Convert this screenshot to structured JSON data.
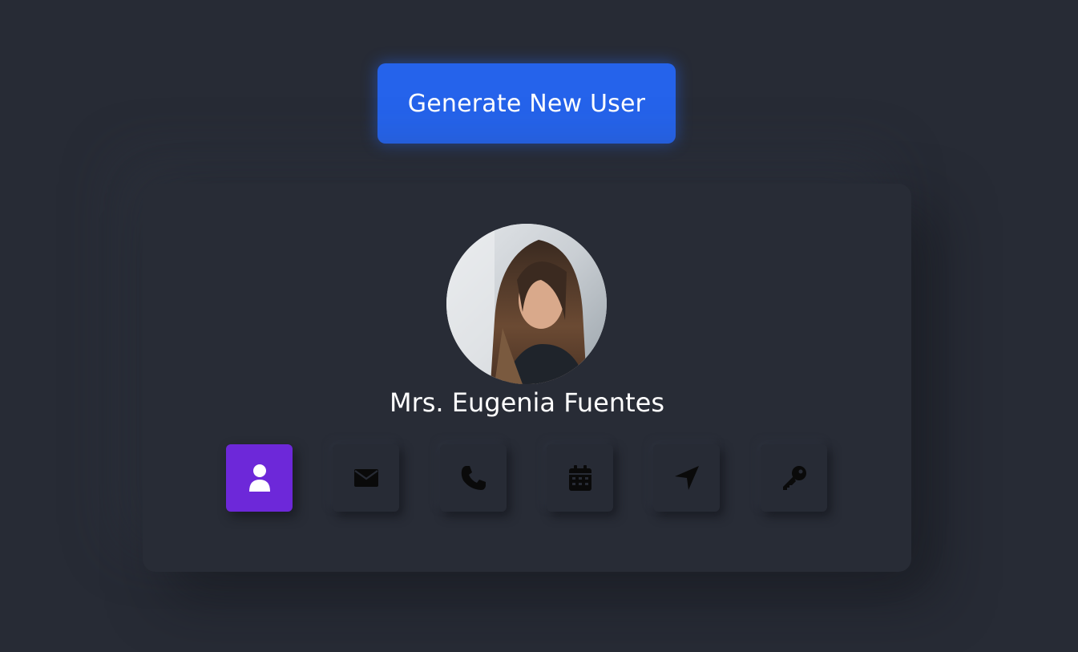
{
  "header": {
    "generate_button_label": "Generate New User"
  },
  "user": {
    "name": "Mrs. Eugenia Fuentes",
    "avatar_icon": "user-photo"
  },
  "tabs": [
    {
      "icon": "user-icon",
      "active": true
    },
    {
      "icon": "envelope-icon",
      "active": false
    },
    {
      "icon": "phone-icon",
      "active": false
    },
    {
      "icon": "calendar-icon",
      "active": false
    },
    {
      "icon": "location-arrow-icon",
      "active": false
    },
    {
      "icon": "key-icon",
      "active": false
    }
  ],
  "colors": {
    "background": "#272b35",
    "primary_button": "#2563eb",
    "active_tab": "#6d28d9",
    "icon_inactive": "#0a0a0a",
    "icon_active": "#ffffff"
  }
}
